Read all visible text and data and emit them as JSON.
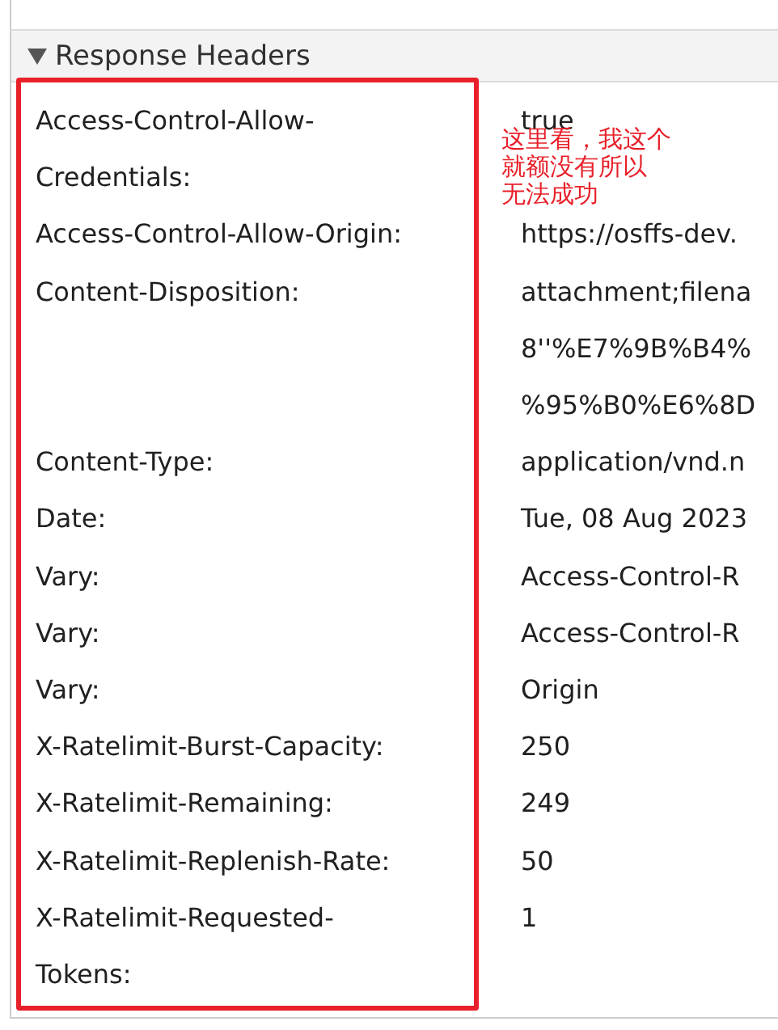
{
  "section": {
    "title": "Response Headers",
    "expanded": true
  },
  "headers": [
    {
      "name": [
        "Access-Control-Allow-",
        "Credentials:"
      ],
      "value": [
        "true"
      ]
    },
    {
      "name": [
        "Access-Control-Allow-Origin:"
      ],
      "value": [
        "https://osffs-dev."
      ]
    },
    {
      "name": [
        "Content-Disposition:"
      ],
      "value": [
        "attachment;filena",
        "8''%E7%9B%B4%",
        "%95%B0%E6%8D"
      ]
    },
    {
      "name": [
        "Content-Type:"
      ],
      "value": [
        "application/vnd.n"
      ]
    },
    {
      "name": [
        "Date:"
      ],
      "value": [
        "Tue, 08 Aug 2023"
      ]
    },
    {
      "name": [
        "Vary:"
      ],
      "value": [
        "Access-Control-R"
      ]
    },
    {
      "name": [
        "Vary:"
      ],
      "value": [
        "Access-Control-R"
      ]
    },
    {
      "name": [
        "Vary:"
      ],
      "value": [
        "Origin"
      ]
    },
    {
      "name": [
        "X-Ratelimit-Burst-Capacity:"
      ],
      "value": [
        "250"
      ]
    },
    {
      "name": [
        "X-Ratelimit-Remaining:"
      ],
      "value": [
        "249"
      ]
    },
    {
      "name": [
        "X-Ratelimit-Replenish-Rate:"
      ],
      "value": [
        "50"
      ]
    },
    {
      "name": [
        "X-Ratelimit-Requested-",
        "Tokens:"
      ],
      "value": [
        "1"
      ]
    }
  ],
  "annotation": {
    "lines": [
      "这里看，我这个",
      "就额没有所以",
      "无法成功"
    ]
  }
}
